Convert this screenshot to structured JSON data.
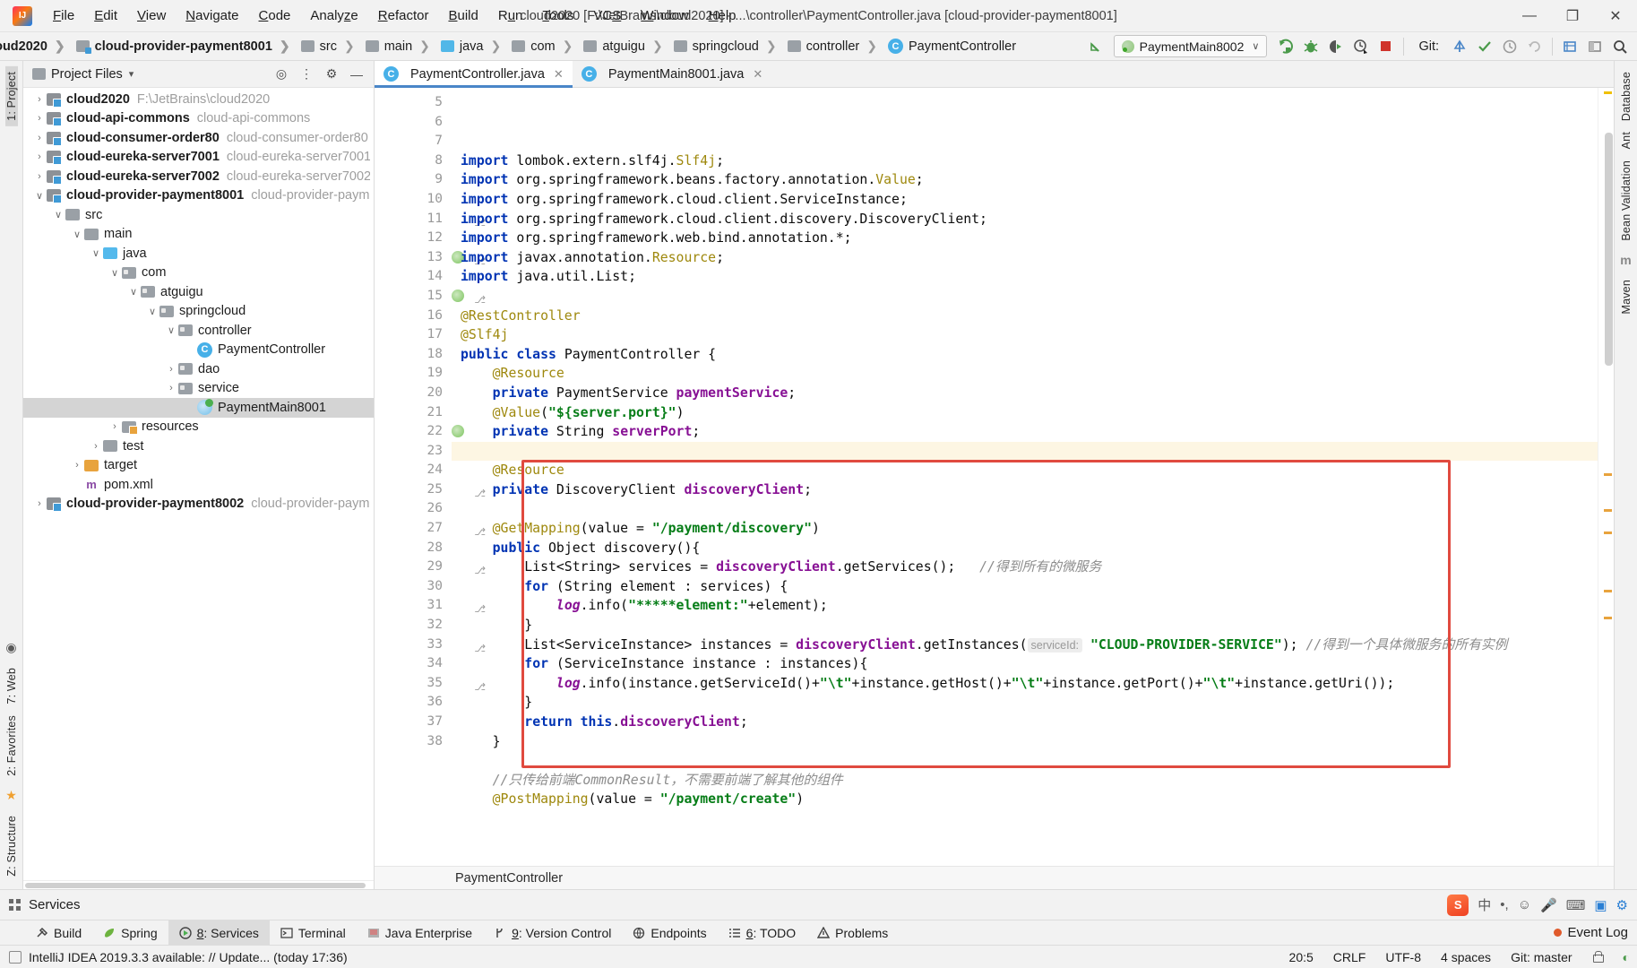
{
  "window": {
    "title": "cloud2020 [F:\\JetBrains\\cloud2020] - ...\\controller\\PaymentController.java [cloud-provider-payment8001]",
    "minimize": "—",
    "maximize": "❐",
    "close": "✕"
  },
  "menu": [
    "File",
    "Edit",
    "View",
    "Navigate",
    "Code",
    "Analyze",
    "Refactor",
    "Build",
    "Run",
    "Tools",
    "VCS",
    "Window",
    "Help"
  ],
  "breadcrumbs": [
    {
      "label": "cloud2020",
      "icon": "module-icon",
      "bold": true,
      "truncated": true
    },
    {
      "label": "cloud-provider-payment8001",
      "icon": "module-icon",
      "bold": true
    },
    {
      "label": "src",
      "icon": "folder-icon",
      "bold": false
    },
    {
      "label": "main",
      "icon": "folder-icon",
      "bold": false
    },
    {
      "label": "java",
      "icon": "source-folder-icon",
      "bold": false
    },
    {
      "label": "com",
      "icon": "package-icon",
      "bold": false
    },
    {
      "label": "atguigu",
      "icon": "package-icon",
      "bold": false
    },
    {
      "label": "springcloud",
      "icon": "package-icon",
      "bold": false
    },
    {
      "label": "controller",
      "icon": "package-icon",
      "bold": false
    },
    {
      "label": "PaymentController",
      "icon": "class-icon",
      "bold": false
    }
  ],
  "toolbar": {
    "run_config": "PaymentMain8002",
    "run_config_caret": "∨",
    "git_label": "Git:",
    "icons": [
      "back-arrow-icon",
      "run-icon",
      "debug-icon",
      "run-coverage-icon",
      "profile-icon",
      "stop-icon",
      "checkmark-icon",
      "update-project-icon",
      "history-icon",
      "commit-icon",
      "settings-icon",
      "search-everywhere-icon"
    ]
  },
  "left_rail": {
    "top": [
      "1: Project"
    ],
    "bottom": [
      "7: Web",
      "2: Favorites",
      "Z: Structure"
    ],
    "star_icon": "favorites-star-icon",
    "web_icon": "web-globe-icon"
  },
  "right_rail": [
    "Database",
    "Ant",
    "Bean Validation",
    "m",
    "Maven"
  ],
  "project_panel": {
    "title": "Project Files",
    "caret": "▾",
    "actions": [
      "locate-icon",
      "collapse-all-icon",
      "settings-gear-icon",
      "hide-icon"
    ],
    "tree": [
      {
        "indent": 0,
        "arrow": "›",
        "icon": "module-icon",
        "name": "cloud2020",
        "loc": "F:\\JetBrains\\cloud2020",
        "bold": true,
        "selected": false
      },
      {
        "indent": 0,
        "arrow": "›",
        "icon": "module-icon",
        "name": "cloud-api-commons",
        "loc": "cloud-api-commons",
        "bold": true,
        "selected": false
      },
      {
        "indent": 0,
        "arrow": "›",
        "icon": "module-icon",
        "name": "cloud-consumer-order80",
        "loc": "cloud-consumer-order80",
        "bold": true,
        "selected": false
      },
      {
        "indent": 0,
        "arrow": "›",
        "icon": "module-icon",
        "name": "cloud-eureka-server7001",
        "loc": "cloud-eureka-server7001",
        "bold": true,
        "selected": false
      },
      {
        "indent": 0,
        "arrow": "›",
        "icon": "module-icon",
        "name": "cloud-eureka-server7002",
        "loc": "cloud-eureka-server7002",
        "bold": true,
        "selected": false
      },
      {
        "indent": 0,
        "arrow": "∨",
        "icon": "module-icon",
        "name": "cloud-provider-payment8001",
        "loc": "cloud-provider-payment",
        "bold": true,
        "selected": false
      },
      {
        "indent": 1,
        "arrow": "∨",
        "icon": "folder-icon",
        "name": "src",
        "loc": "",
        "bold": false,
        "selected": false
      },
      {
        "indent": 2,
        "arrow": "∨",
        "icon": "folder-icon",
        "name": "main",
        "loc": "",
        "bold": false,
        "selected": false
      },
      {
        "indent": 3,
        "arrow": "∨",
        "icon": "source-folder-icon",
        "name": "java",
        "loc": "",
        "bold": false,
        "selected": false
      },
      {
        "indent": 4,
        "arrow": "∨",
        "icon": "package-icon",
        "name": "com",
        "loc": "",
        "bold": false,
        "selected": false
      },
      {
        "indent": 5,
        "arrow": "∨",
        "icon": "package-icon",
        "name": "atguigu",
        "loc": "",
        "bold": false,
        "selected": false
      },
      {
        "indent": 6,
        "arrow": "∨",
        "icon": "package-icon",
        "name": "springcloud",
        "loc": "",
        "bold": false,
        "selected": false
      },
      {
        "indent": 7,
        "arrow": "∨",
        "icon": "package-icon",
        "name": "controller",
        "loc": "",
        "bold": false,
        "selected": false
      },
      {
        "indent": 8,
        "arrow": "",
        "icon": "class-icon",
        "name": "PaymentController",
        "loc": "",
        "bold": false,
        "selected": false
      },
      {
        "indent": 7,
        "arrow": "›",
        "icon": "package-icon",
        "name": "dao",
        "loc": "",
        "bold": false,
        "selected": false
      },
      {
        "indent": 7,
        "arrow": "›",
        "icon": "package-icon",
        "name": "service",
        "loc": "",
        "bold": false,
        "selected": false
      },
      {
        "indent": 8,
        "arrow": "",
        "icon": "spring-class-icon",
        "name": "PaymentMain8001",
        "loc": "",
        "bold": false,
        "selected": true
      },
      {
        "indent": 4,
        "arrow": "›",
        "icon": "resource-folder-icon",
        "name": "resources",
        "loc": "",
        "bold": false,
        "selected": false
      },
      {
        "indent": 3,
        "arrow": "›",
        "icon": "folder-icon",
        "name": "test",
        "loc": "",
        "bold": false,
        "selected": false
      },
      {
        "indent": 2,
        "arrow": "›",
        "icon": "target-folder-icon",
        "name": "target",
        "loc": "",
        "bold": false,
        "selected": false
      },
      {
        "indent": 2,
        "arrow": "",
        "icon": "maven-icon",
        "name": "pom.xml",
        "loc": "",
        "bold": false,
        "selected": false
      },
      {
        "indent": 0,
        "arrow": "›",
        "icon": "module-icon",
        "name": "cloud-provider-payment8002",
        "loc": "cloud-provider-payment",
        "bold": true,
        "selected": false
      }
    ]
  },
  "editor": {
    "tabs": [
      {
        "label": "PaymentController.java",
        "icon": "class-icon",
        "active": true,
        "close": "✕"
      },
      {
        "label": "PaymentMain8001.java",
        "icon": "class-icon",
        "active": false,
        "close": "✕"
      }
    ],
    "first_line_number": 5,
    "lines": [
      {
        "n": 5,
        "html": "<span class=\"kw\">import</span> lombok.extern.slf4j.<span class=\"ann\">Slf4j</span>;"
      },
      {
        "n": 6,
        "html": "<span class=\"kw\">import</span> org.springframework.beans.factory.annotation.<span class=\"ann\">Value</span>;"
      },
      {
        "n": 7,
        "html": "<span class=\"kw\">import</span> org.springframework.cloud.client.ServiceInstance;"
      },
      {
        "n": 8,
        "html": "<span class=\"kw\">import</span> org.springframework.cloud.client.discovery.DiscoveryClient;"
      },
      {
        "n": 9,
        "html": "<span class=\"kw\">import</span> org.springframework.web.bind.annotation.*;"
      },
      {
        "n": 10,
        "html": "<span class=\"kw\">import</span> javax.annotation.<span class=\"ann\">Resource</span>;"
      },
      {
        "n": 11,
        "html": "<span class=\"kw\">import</span> java.util.List;"
      },
      {
        "n": 12,
        "html": ""
      },
      {
        "n": 13,
        "html": "<span class=\"ann\">@RestController</span>"
      },
      {
        "n": 14,
        "html": "<span class=\"ann\">@Slf4j</span>"
      },
      {
        "n": 15,
        "html": "<span class=\"kw\">public class</span> PaymentController {"
      },
      {
        "n": 16,
        "html": "    <span class=\"ann\">@Resource</span>"
      },
      {
        "n": 17,
        "html": "    <span class=\"kw\">private</span> PaymentService <span class=\"fld\">paymentService</span>;"
      },
      {
        "n": 18,
        "html": "    <span class=\"ann\">@Value</span>(<span class=\"str\">\"${server.port}\"</span>)"
      },
      {
        "n": 19,
        "html": "    <span class=\"kw\">private</span> String <span class=\"fld\">serverPort</span>;"
      },
      {
        "n": 20,
        "html": "",
        "highlight": true
      },
      {
        "n": 21,
        "html": "    <span class=\"ann\">@Resource</span>"
      },
      {
        "n": 22,
        "html": "    <span class=\"kw\">private</span> DiscoveryClient <span class=\"fld\">discoveryClient</span>;"
      },
      {
        "n": 23,
        "html": ""
      },
      {
        "n": 24,
        "html": "    <span class=\"ann\">@GetMapping</span>(value = <span class=\"str\">\"/payment/discovery\"</span>)"
      },
      {
        "n": 25,
        "html": "    <span class=\"kw\">public</span> Object discovery(){"
      },
      {
        "n": 26,
        "html": "        List&lt;String&gt; services = <span class=\"fld\">discoveryClient</span>.getServices();   <span class=\"cmt\">//得到所有的微服务</span>"
      },
      {
        "n": 27,
        "html": "        <span class=\"kw\">for</span> (String element : services) {"
      },
      {
        "n": 28,
        "html": "            <span class=\"fld\"><i>log</i></span>.info(<span class=\"str\">\"*****element:\"</span>+element);"
      },
      {
        "n": 29,
        "html": "        }"
      },
      {
        "n": 30,
        "html": "        List&lt;ServiceInstance&gt; instances = <span class=\"fld\">discoveryClient</span>.getInstances(<span class=\"hint\">serviceId:</span> <span class=\"str\">\"CLOUD-PROVIDER-SERVICE\"</span>); <span class=\"cmt\">//得到一个具体微服务的所有实例</span>"
      },
      {
        "n": 31,
        "html": "        <span class=\"kw\">for</span> (ServiceInstance instance : instances){"
      },
      {
        "n": 32,
        "html": "            <span class=\"fld\"><i>log</i></span>.info(instance.getServiceId()+<span class=\"str\">\"\\t\"</span>+instance.getHost()+<span class=\"str\">\"\\t\"</span>+instance.getPort()+<span class=\"str\">\"\\t\"</span>+instance.getUri());"
      },
      {
        "n": 33,
        "html": "        }"
      },
      {
        "n": 34,
        "html": "        <span class=\"kw\">return this</span>.<span class=\"fld\">discoveryClient</span>;"
      },
      {
        "n": 35,
        "html": "    }"
      },
      {
        "n": 36,
        "html": ""
      },
      {
        "n": 37,
        "html": "    <span class=\"cmt\">//只传给前端CommonResult，不需要前端了解其他的组件</span>"
      },
      {
        "n": 38,
        "html": "    <span class=\"ann\">@PostMapping</span>(value = <span class=\"str\">\"/payment/create\"</span>)"
      }
    ],
    "breadcrumb_bottom": "PaymentController"
  },
  "services_panel": {
    "title": "Services"
  },
  "toolwindow_bar": [
    {
      "label": "Build",
      "icon": "build-hammer-icon",
      "selected": false,
      "mnemonic": ""
    },
    {
      "label": "Spring",
      "icon": "spring-leaf-icon",
      "selected": false,
      "mnemonic": ""
    },
    {
      "label": "8: Services",
      "icon": "services-run-icon",
      "selected": true,
      "mnemonic": "8"
    },
    {
      "label": "Terminal",
      "icon": "terminal-icon",
      "selected": false,
      "mnemonic": ""
    },
    {
      "label": "Java Enterprise",
      "icon": "java-enterprise-icon",
      "selected": false,
      "mnemonic": ""
    },
    {
      "label": "9: Version Control",
      "icon": "vcs-branch-icon",
      "selected": false,
      "mnemonic": "9"
    },
    {
      "label": "Endpoints",
      "icon": "endpoints-icon",
      "selected": false,
      "mnemonic": ""
    },
    {
      "label": "6: TODO",
      "icon": "todo-list-icon",
      "selected": true,
      "mnemonic": "6"
    },
    {
      "label": "Problems",
      "icon": "problems-warning-icon",
      "selected": false,
      "mnemonic": ""
    }
  ],
  "event_log": {
    "label": "Event Log",
    "dot": "notification-dot"
  },
  "status_bar": {
    "message": "IntelliJ IDEA 2019.3.3 available: // Update... (today 17:36)",
    "caret": "20:5",
    "line_sep": "CRLF",
    "encoding": "UTF-8",
    "indent": "4 spaces",
    "git_branch": "Git: master",
    "lock_icon": "read-only-lock-icon",
    "notification_icon": "ide-update-icon"
  },
  "tray": {
    "ime": "中",
    "icons": [
      "sogou-icon",
      "ime-cn-icon",
      "punctuation-icon",
      "smiley-icon",
      "mic-icon",
      "keyboard-icon",
      "toolbox-icon",
      "settings-icon"
    ]
  },
  "colors": {
    "accent": "#4a86c8",
    "highlight_box": "#e04a3f",
    "selection": "#d4d4d4",
    "string": "#067d17",
    "keyword": "#0033b3",
    "annotation": "#9e880d",
    "field": "#871094",
    "comment": "#8c8c8c"
  }
}
